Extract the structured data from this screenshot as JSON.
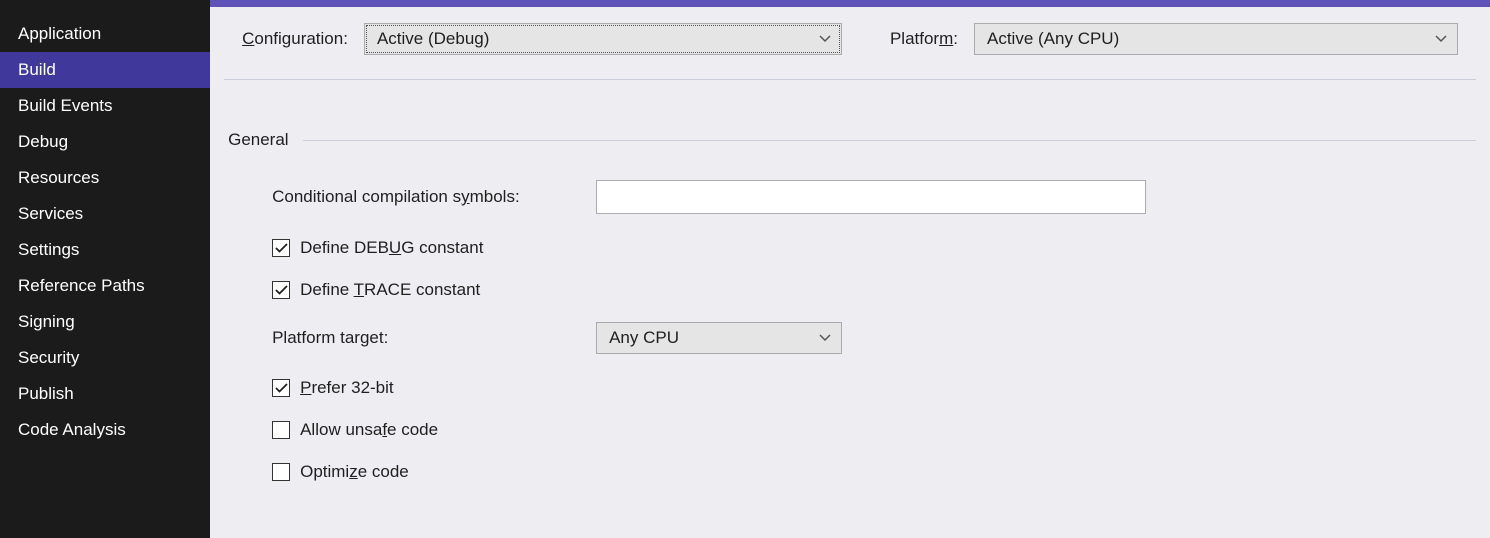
{
  "sidebar": {
    "items": [
      {
        "label": "Application"
      },
      {
        "label": "Build"
      },
      {
        "label": "Build Events"
      },
      {
        "label": "Debug"
      },
      {
        "label": "Resources"
      },
      {
        "label": "Services"
      },
      {
        "label": "Settings"
      },
      {
        "label": "Reference Paths"
      },
      {
        "label": "Signing"
      },
      {
        "label": "Security"
      },
      {
        "label": "Publish"
      },
      {
        "label": "Code Analysis"
      }
    ],
    "active_index": 1
  },
  "config_bar": {
    "configuration_label": "Configuration:",
    "configuration_value": "Active (Debug)",
    "platform_label": "Platform:",
    "platform_value": "Active (Any CPU)"
  },
  "section": {
    "title": "General"
  },
  "form": {
    "symbols_label": "Conditional compilation symbols:",
    "symbols_value": "",
    "define_debug": {
      "label_pre": "Define DEB",
      "label_u": "U",
      "label_post": "G constant",
      "checked": true
    },
    "define_trace": {
      "label_pre": "Define ",
      "label_u": "T",
      "label_post": "RACE constant",
      "checked": true
    },
    "platform_target_label": "Platform target:",
    "platform_target_value": "Any CPU",
    "prefer_32": {
      "label_u": "P",
      "label_post": "refer 32-bit",
      "checked": true
    },
    "allow_unsafe": {
      "label_pre": "Allow unsa",
      "label_u": "f",
      "label_post": "e code",
      "checked": false
    },
    "optimize": {
      "label_pre": "Optimi",
      "label_u": "z",
      "label_post": "e code",
      "checked": false
    }
  }
}
